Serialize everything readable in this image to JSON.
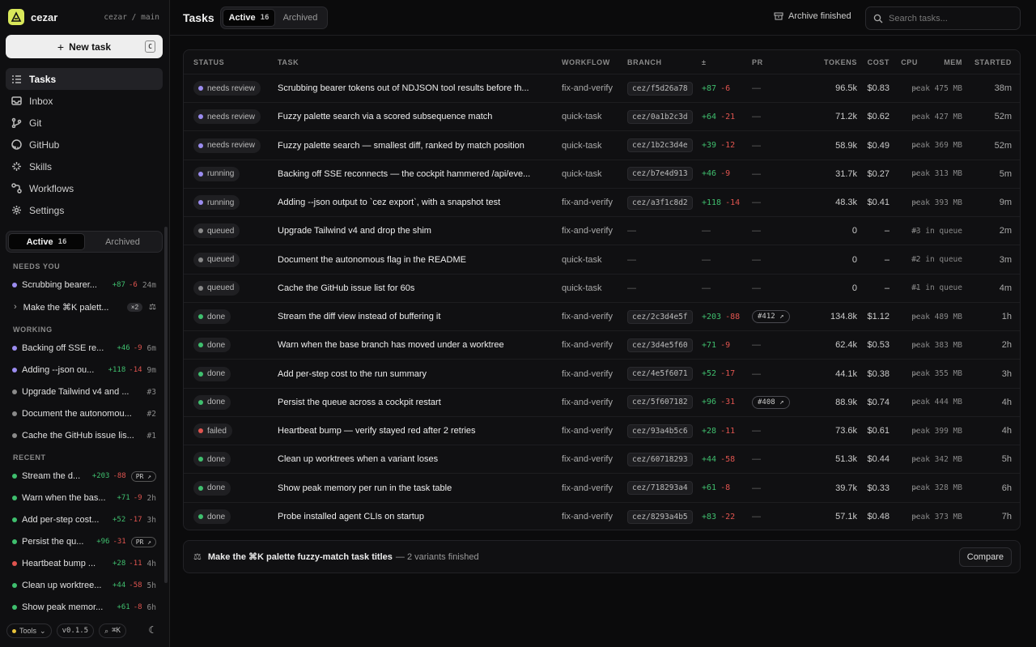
{
  "brand": {
    "name": "cezar",
    "repo": "cezar / main"
  },
  "sidebar": {
    "new_task_label": "New task",
    "new_task_kbd": "C",
    "nav": [
      {
        "label": "Tasks",
        "icon": "tasks-icon",
        "active": true
      },
      {
        "label": "Inbox",
        "icon": "inbox-icon"
      },
      {
        "label": "Git",
        "icon": "git-icon"
      },
      {
        "label": "GitHub",
        "icon": "github-icon"
      },
      {
        "label": "Skills",
        "icon": "skills-icon"
      },
      {
        "label": "Workflows",
        "icon": "workflows-icon"
      },
      {
        "label": "Settings",
        "icon": "settings-icon"
      }
    ],
    "tabs": {
      "active_label": "Active",
      "active_count": "16",
      "archived_label": "Archived"
    },
    "needs_you_header": "NEEDS YOU",
    "needs_you": [
      {
        "title": "Scrubbing bearer...",
        "add": "+87",
        "del": "-6",
        "time": "24m",
        "color": "#9b8cf0"
      },
      {
        "title": "Make the ⌘K palett...",
        "badge": "×2"
      }
    ],
    "working_header": "WORKING",
    "working": [
      {
        "title": "Backing off SSE re...",
        "add": "+46",
        "del": "-9",
        "time": "6m",
        "color": "#9b8cf0"
      },
      {
        "title": "Adding --json ou...",
        "add": "+118",
        "del": "-14",
        "time": "9m",
        "color": "#9b8cf0"
      },
      {
        "title": "Upgrade Tailwind v4 and ...",
        "queue": "#3",
        "color": "#8a8a8a"
      },
      {
        "title": "Document the autonomou...",
        "queue": "#2",
        "color": "#8a8a8a"
      },
      {
        "title": "Cache the GitHub issue lis...",
        "queue": "#1",
        "color": "#8a8a8a"
      }
    ],
    "recent_header": "RECENT",
    "recent": [
      {
        "title": "Stream the d...",
        "add": "+203",
        "del": "-88",
        "pr": "PR ↗",
        "color": "#3fbf6e"
      },
      {
        "title": "Warn when the bas...",
        "add": "+71",
        "del": "-9",
        "time": "2h",
        "color": "#3fbf6e"
      },
      {
        "title": "Add per-step cost...",
        "add": "+52",
        "del": "-17",
        "time": "3h",
        "color": "#3fbf6e"
      },
      {
        "title": "Persist the qu...",
        "add": "+96",
        "del": "-31",
        "pr": "PR ↗",
        "color": "#3fbf6e"
      },
      {
        "title": "Heartbeat bump ...",
        "add": "+28",
        "del": "-11",
        "time": "4h",
        "color": "#e0544f"
      },
      {
        "title": "Clean up worktree...",
        "add": "+44",
        "del": "-58",
        "time": "5h",
        "color": "#3fbf6e"
      },
      {
        "title": "Show peak memor...",
        "add": "+61",
        "del": "-8",
        "time": "6h",
        "color": "#3fbf6e"
      }
    ],
    "footer": {
      "tools_label": "Tools",
      "version": "v0.1.5",
      "search_kbd": "⌘K"
    }
  },
  "header": {
    "title": "Tasks",
    "tab_active_label": "Active",
    "tab_active_count": "16",
    "tab_archived_label": "Archived",
    "archive_finished_label": "Archive finished",
    "search_placeholder": "Search tasks..."
  },
  "table": {
    "columns": [
      "STATUS",
      "TASK",
      "WORKFLOW",
      "BRANCH",
      "±",
      "PR",
      "TOKENS",
      "COST",
      "CPU",
      "MEM",
      "STARTED"
    ],
    "rows": [
      {
        "status": "needs review",
        "color": "#9b8cf0",
        "task": "Scrubbing bearer tokens out of NDJSON tool results before th...",
        "workflow": "fix-and-verify",
        "branch": "cez/f5d26a78",
        "add": "+87",
        "del": "-6",
        "pr": "—",
        "tokens": "96.5k",
        "cost": "$0.83",
        "cpu": "–",
        "mem": "peak 475 MB",
        "started": "38m"
      },
      {
        "status": "needs review",
        "color": "#9b8cf0",
        "task": "Fuzzy palette search via a scored subsequence match",
        "workflow": "quick-task",
        "branch": "cez/0a1b2c3d",
        "add": "+64",
        "del": "-21",
        "pr": "—",
        "tokens": "71.2k",
        "cost": "$0.62",
        "cpu": "–",
        "mem": "peak 427 MB",
        "started": "52m"
      },
      {
        "status": "needs review",
        "color": "#9b8cf0",
        "task": "Fuzzy palette search — smallest diff, ranked by match position",
        "workflow": "quick-task",
        "branch": "cez/1b2c3d4e",
        "add": "+39",
        "del": "-12",
        "pr": "—",
        "tokens": "58.9k",
        "cost": "$0.49",
        "cpu": "–",
        "mem": "peak 369 MB",
        "started": "52m"
      },
      {
        "status": "running",
        "color": "#9b8cf0",
        "task": "Backing off SSE reconnects — the cockpit hammered /api/eve...",
        "workflow": "quick-task",
        "branch": "cez/b7e4d913",
        "add": "+46",
        "del": "-9",
        "pr": "—",
        "tokens": "31.7k",
        "cost": "$0.27",
        "cpu": "–",
        "mem": "peak 313 MB",
        "started": "5m"
      },
      {
        "status": "running",
        "color": "#9b8cf0",
        "task": "Adding --json output to `cez export`, with a snapshot test",
        "workflow": "fix-and-verify",
        "branch": "cez/a3f1c8d2",
        "add": "+118",
        "del": "-14",
        "pr": "—",
        "tokens": "48.3k",
        "cost": "$0.41",
        "cpu": "–",
        "mem": "peak 393 MB",
        "started": "9m"
      },
      {
        "status": "queued",
        "color": "#8a8a8a",
        "task": "Upgrade Tailwind v4 and drop the shim",
        "workflow": "fix-and-verify",
        "branch": "",
        "add": "",
        "del": "",
        "pr": "—",
        "tokens": "0",
        "cost": "–",
        "cpu": "–",
        "mem": "#3 in queue",
        "started": "2m"
      },
      {
        "status": "queued",
        "color": "#8a8a8a",
        "task": "Document the autonomous flag in the README",
        "workflow": "quick-task",
        "branch": "",
        "add": "",
        "del": "",
        "pr": "—",
        "tokens": "0",
        "cost": "–",
        "cpu": "–",
        "mem": "#2 in queue",
        "started": "3m"
      },
      {
        "status": "queued",
        "color": "#8a8a8a",
        "task": "Cache the GitHub issue list for 60s",
        "workflow": "quick-task",
        "branch": "",
        "add": "",
        "del": "",
        "pr": "—",
        "tokens": "0",
        "cost": "–",
        "cpu": "–",
        "mem": "#1 in queue",
        "started": "4m"
      },
      {
        "status": "done",
        "color": "#3fbf6e",
        "task": "Stream the diff view instead of buffering it",
        "workflow": "fix-and-verify",
        "branch": "cez/2c3d4e5f",
        "add": "+203",
        "del": "-88",
        "pr": "#412 ↗",
        "tokens": "134.8k",
        "cost": "$1.12",
        "cpu": "–",
        "mem": "peak 489 MB",
        "started": "1h"
      },
      {
        "status": "done",
        "color": "#3fbf6e",
        "task": "Warn when the base branch has moved under a worktree",
        "workflow": "fix-and-verify",
        "branch": "cez/3d4e5f60",
        "add": "+71",
        "del": "-9",
        "pr": "—",
        "tokens": "62.4k",
        "cost": "$0.53",
        "cpu": "–",
        "mem": "peak 383 MB",
        "started": "2h"
      },
      {
        "status": "done",
        "color": "#3fbf6e",
        "task": "Add per-step cost to the run summary",
        "workflow": "fix-and-verify",
        "branch": "cez/4e5f6071",
        "add": "+52",
        "del": "-17",
        "pr": "—",
        "tokens": "44.1k",
        "cost": "$0.38",
        "cpu": "–",
        "mem": "peak 355 MB",
        "started": "3h"
      },
      {
        "status": "done",
        "color": "#3fbf6e",
        "task": "Persist the queue across a cockpit restart",
        "workflow": "fix-and-verify",
        "branch": "cez/5f607182",
        "add": "+96",
        "del": "-31",
        "pr": "#408 ↗",
        "tokens": "88.9k",
        "cost": "$0.74",
        "cpu": "–",
        "mem": "peak 444 MB",
        "started": "4h"
      },
      {
        "status": "failed",
        "color": "#e0544f",
        "task": "Heartbeat bump — verify stayed red after 2 retries",
        "workflow": "fix-and-verify",
        "branch": "cez/93a4b5c6",
        "add": "+28",
        "del": "-11",
        "pr": "—",
        "tokens": "73.6k",
        "cost": "$0.61",
        "cpu": "–",
        "mem": "peak 399 MB",
        "started": "4h"
      },
      {
        "status": "done",
        "color": "#3fbf6e",
        "task": "Clean up worktrees when a variant loses",
        "workflow": "fix-and-verify",
        "branch": "cez/60718293",
        "add": "+44",
        "del": "-58",
        "pr": "—",
        "tokens": "51.3k",
        "cost": "$0.44",
        "cpu": "–",
        "mem": "peak 342 MB",
        "started": "5h"
      },
      {
        "status": "done",
        "color": "#3fbf6e",
        "task": "Show peak memory per run in the task table",
        "workflow": "fix-and-verify",
        "branch": "cez/718293a4",
        "add": "+61",
        "del": "-8",
        "pr": "—",
        "tokens": "39.7k",
        "cost": "$0.33",
        "cpu": "–",
        "mem": "peak 328 MB",
        "started": "6h"
      },
      {
        "status": "done",
        "color": "#3fbf6e",
        "task": "Probe installed agent CLIs on startup",
        "workflow": "fix-and-verify",
        "branch": "cez/8293a4b5",
        "add": "+83",
        "del": "-22",
        "pr": "—",
        "tokens": "57.1k",
        "cost": "$0.48",
        "cpu": "–",
        "mem": "peak 373 MB",
        "started": "7h"
      }
    ]
  },
  "banner": {
    "title": "Make the ⌘K palette fuzzy-match task titles",
    "rest": "— 2 variants finished",
    "compare_label": "Compare"
  }
}
